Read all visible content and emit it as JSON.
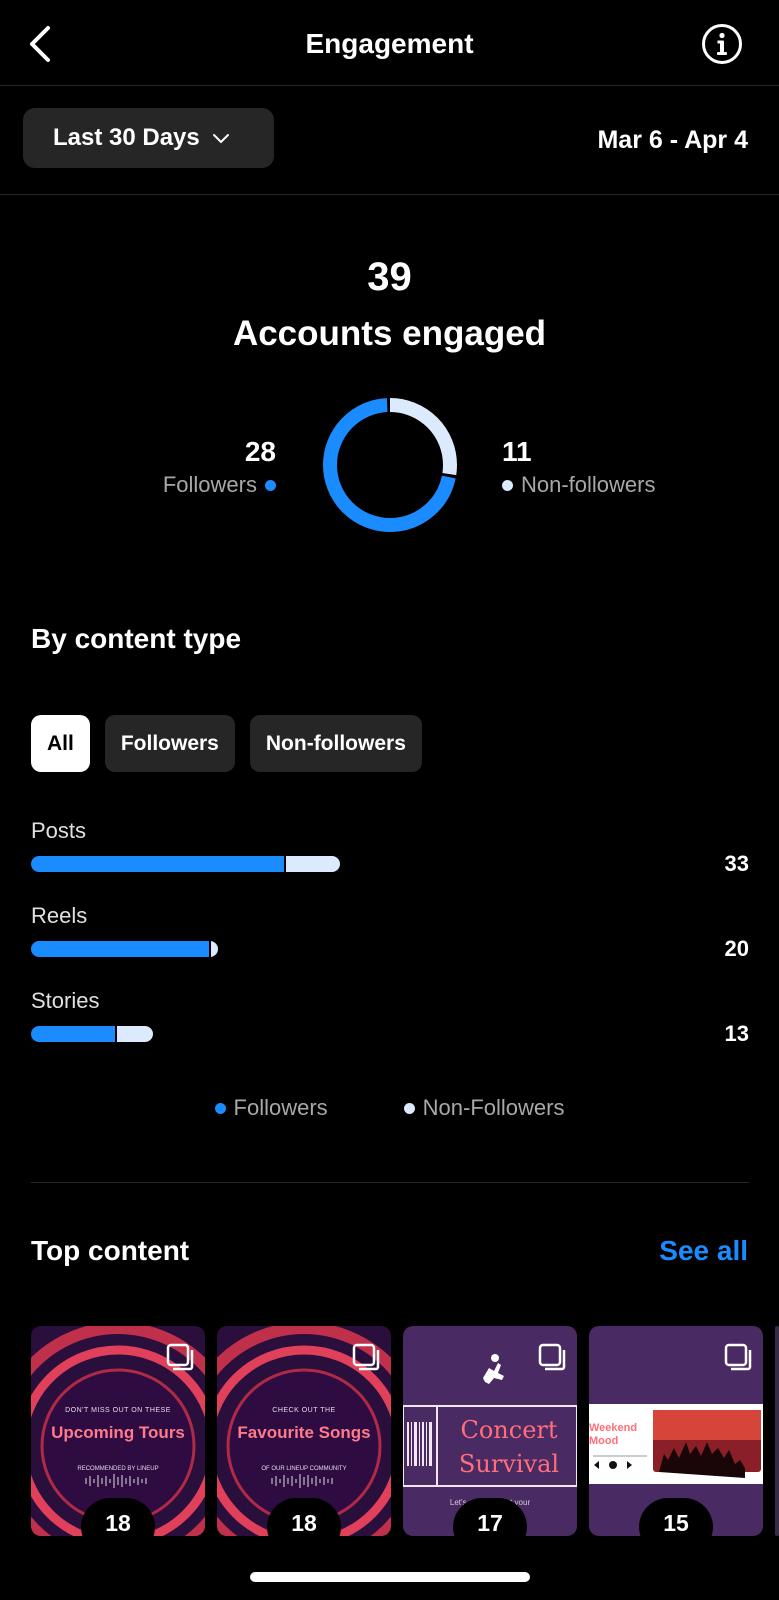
{
  "header": {
    "title": "Engagement"
  },
  "filter": {
    "range_label": "Last 30 Days",
    "date_range": "Mar 6 - Apr 4"
  },
  "summary": {
    "total": "39",
    "total_label": "Accounts engaged",
    "followers_count": "28",
    "followers_label": "Followers",
    "non_followers_count": "11",
    "non_followers_label": "Non-followers",
    "followers_fraction": 0.718
  },
  "content_type": {
    "heading": "By content type",
    "chips": [
      "All",
      "Followers",
      "Non-followers"
    ],
    "active_chip": "All",
    "rows": [
      {
        "label": "Posts",
        "value": "33",
        "followers": 27,
        "non_followers": 6
      },
      {
        "label": "Reels",
        "value": "20",
        "followers": 19,
        "non_followers": 1
      },
      {
        "label": "Stories",
        "value": "13",
        "followers": 9,
        "non_followers": 4
      }
    ],
    "legend": {
      "followers": "Followers",
      "non_followers": "Non-Followers"
    }
  },
  "top_content": {
    "heading": "Top content",
    "see_all": "See all",
    "items": [
      {
        "top": "DON'T MISS OUT ON THESE",
        "title": "Upcoming Tours",
        "sub": "RECOMMENDED BY LINEUP",
        "count": "18"
      },
      {
        "top": "CHECK OUT THE",
        "title": "Favourite Songs",
        "sub": "OF OUR LINEUP COMMUNITY",
        "count": "18"
      },
      {
        "title": "Concert Survival",
        "sub": "Let's get ... ck out your",
        "count": "17"
      },
      {
        "title": "Weekend Mood",
        "count": "15"
      }
    ]
  },
  "colors": {
    "followers": "#1a8cff",
    "non_followers": "#dbeafc",
    "link": "#1a8cff"
  }
}
